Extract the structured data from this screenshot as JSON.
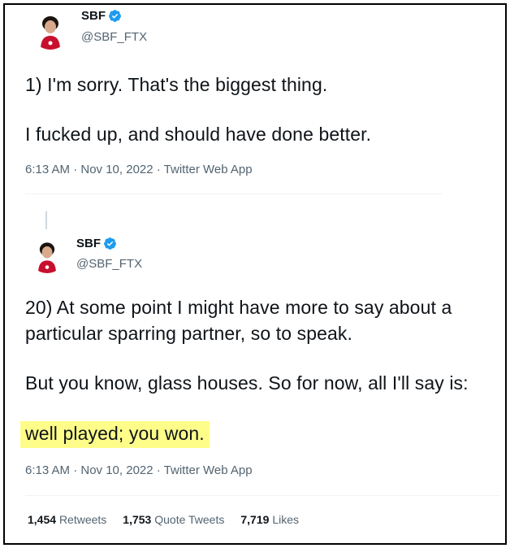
{
  "tweet1": {
    "display_name": "SBF",
    "handle": "@SBF_FTX",
    "line1": "1) I'm sorry.  That's the biggest thing.",
    "line2": "I fucked up, and should have done better.",
    "meta": "6:13 AM · Nov 10, 2022 · Twitter Web App"
  },
  "tweet2": {
    "display_name": "SBF",
    "handle": "@SBF_FTX",
    "line1": "20) At some point I might have more to say about a",
    "line2": "particular sparring partner, so to speak.",
    "line3": "But you know, glass houses.  So for now, all I'll say is:",
    "line4": "well played; you won.",
    "meta": "6:13 AM · Nov 10, 2022 · Twitter Web App"
  },
  "stats": {
    "retweets_count": "1,454",
    "retweets_label": "Retweets",
    "quotes_count": "1,753",
    "quotes_label": "Quote Tweets",
    "likes_count": "7,719",
    "likes_label": "Likes"
  },
  "colors": {
    "verified": "#1d9bf0",
    "highlight": "#fffd8a",
    "secondary_text": "#536471"
  },
  "icons": {
    "verified": "verified-badge-icon"
  }
}
